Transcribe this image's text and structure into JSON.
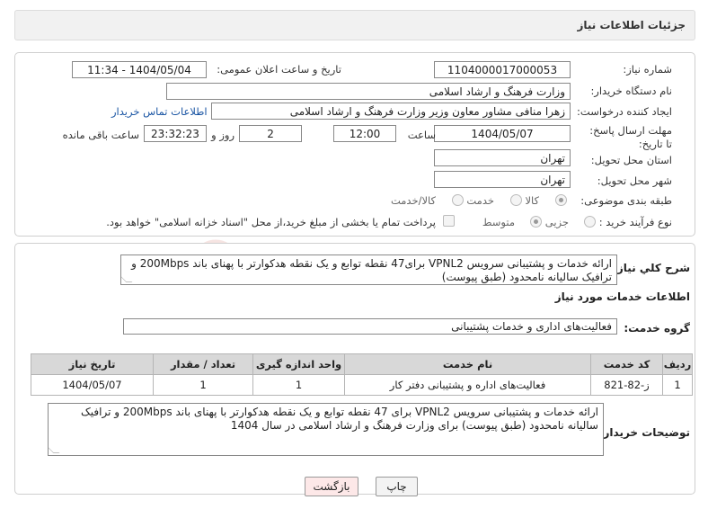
{
  "header": {
    "title": "جزئیات اطلاعات نیاز"
  },
  "labels": {
    "need_number": "شماره نیاز:",
    "announce_datetime": "تاریخ و ساعت اعلان عمومی:",
    "buyer_org": "نام دستگاه خریدار:",
    "requester": "ایجاد کننده درخواست:",
    "deadline": "مهلت ارسال پاسخ: تا تاریخ:",
    "time_word": "ساعت",
    "days_and": "روز و",
    "remaining": "ساعت باقی مانده",
    "province": "استان محل تحویل:",
    "city": "شهر محل تحویل:",
    "category": "طبقه بندی موضوعی:",
    "purchase_type": "نوع فرآیند خرید :",
    "general_desc": "شرح کلي نياز:",
    "services_info": "اطلاعات خدمات مورد نیاز",
    "service_group": "گروه خدمت:",
    "buyer_desc": "توضیحات خریدار:"
  },
  "fields": {
    "need_number": "1104000017000053",
    "announce_datetime": "1404/05/04 - 11:34",
    "buyer_org": "وزارت فرهنگ و ارشاد اسلامی",
    "requester": "زهرا منافی مشاور معاون وزیر وزارت فرهنگ و ارشاد اسلامی",
    "deadline_date": "1404/05/07",
    "deadline_time": "12:00",
    "days": "2",
    "remaining_time": "23:32:23",
    "province": "تهران",
    "city": "تهران",
    "service_group": "فعالیت‌های اداری و خدمات پشتیبانی"
  },
  "links": {
    "buyer_contact": "اطلاعات تماس خریدار"
  },
  "category_options": {
    "goods": "کالا",
    "service": "خدمت",
    "goods_service": "کالا/خدمت"
  },
  "purchase_options": {
    "minor": "جزیی",
    "medium": "متوسط"
  },
  "payment_note": "پرداخت تمام یا بخشی از مبلغ خرید،از محل \"اسناد خزانه اسلامی\" خواهد بود.",
  "general_desc_text": "ارائه خدمات و پشتیبانی سرویس VPNL2 برای47 نقطه توابع و یک نقطه هدکوارتر با پهنای باند 200Mbps و ترافیک سالیانه نامحدود (طبق پیوست)",
  "table": {
    "headers": [
      "ردیف",
      "کد خدمت",
      "نام خدمت",
      "واحد اندازه گیری",
      "تعداد / مقدار",
      "تاریخ نیاز"
    ],
    "rows": [
      [
        "1",
        "ز-82-821",
        "فعالیت‌های اداره و پشتیبانی دفتر کار",
        "1",
        "1",
        "1404/05/07"
      ]
    ]
  },
  "buyer_desc_text": "ارائه خدمات و پشتیبانی سرویس VPNL2 برای 47 نقطه توابع و یک نقطه هدکوارتر با پهنای باند 200Mbps و ترافیک سالیانه نامحدود (طبق پیوست) برای وزارت فرهنگ و ارشاد اسلامی در سال 1404",
  "buttons": {
    "print": "چاپ",
    "back": "بازگشت"
  },
  "watermark": "AriaTender.neT",
  "colors": {
    "link": "#1a55a3",
    "watermark": "#c0392b",
    "back_button_bg": "#fde8e8"
  }
}
